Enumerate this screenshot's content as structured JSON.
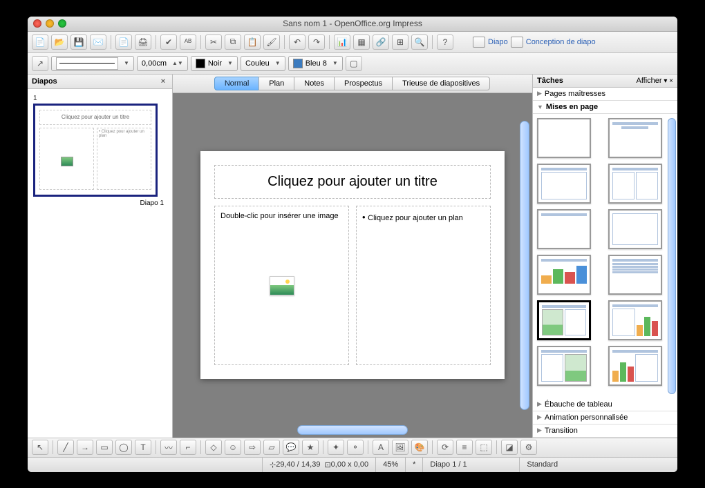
{
  "window": {
    "title": "Sans nom 1 - OpenOffice.org Impress"
  },
  "toolbar1": {
    "diapo_label": "Diapo",
    "conception_label": "Conception de diapo"
  },
  "toolbar2": {
    "width_value": "0,00cm",
    "color_name": "Noir",
    "fill_label": "Couleu",
    "color2_name": "Bleu 8"
  },
  "panel_left": {
    "title": "Diapos",
    "slide_number": "1",
    "thumb_title": "Cliquez pour ajouter un titre",
    "thumb_img_hint": "Double-clic pour insérer une image",
    "thumb_plan_hint": "• Cliquez pour ajouter un plan",
    "thumb_label": "Diapo 1"
  },
  "view_tabs": [
    "Normal",
    "Plan",
    "Notes",
    "Prospectus",
    "Trieuse de diapositives"
  ],
  "slide": {
    "title_placeholder": "Cliquez pour ajouter un titre",
    "image_hint": "Double-clic pour insérer une image",
    "outline_hint": "Cliquez pour ajouter un plan"
  },
  "panel_right": {
    "title": "Tâches",
    "afficher": "Afficher",
    "sections": {
      "pages_maitresses": "Pages maîtresses",
      "mises_en_page": "Mises en page",
      "ebauche": "Ébauche de tableau",
      "animation": "Animation personnalisée",
      "transition": "Transition"
    }
  },
  "status": {
    "coords": "29,40 / 14,39",
    "size": "0,00 x 0,00",
    "zoom": "45%",
    "modified": "*",
    "slide_info": "Diapo 1 / 1",
    "template": "Standard"
  }
}
